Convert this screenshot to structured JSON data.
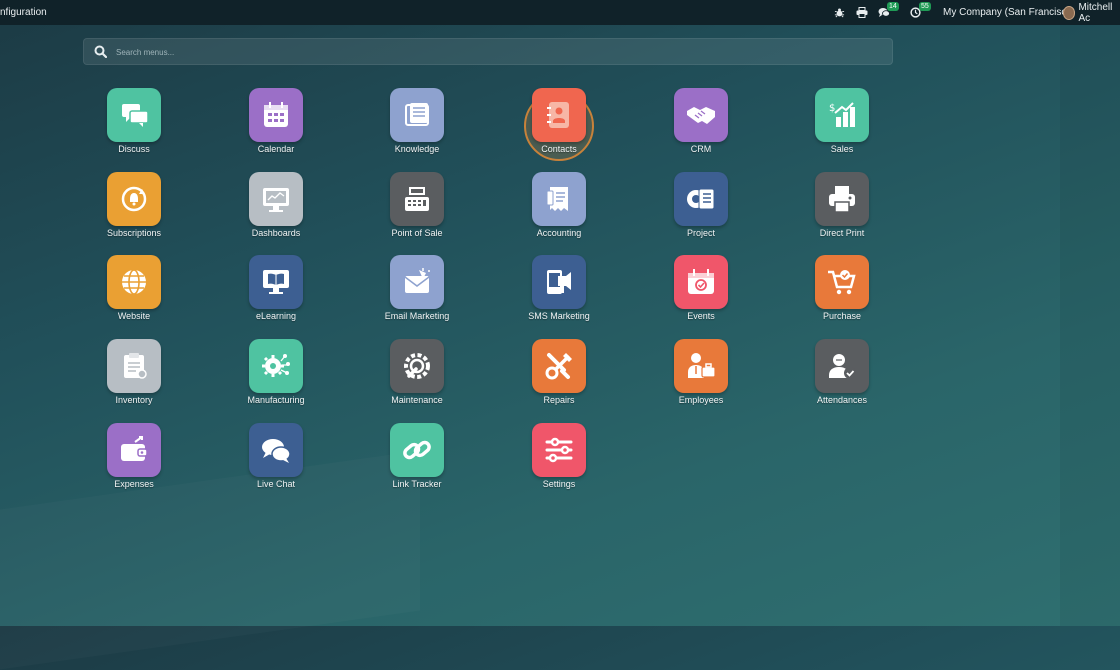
{
  "topbar": {
    "breadcrumb": "nfiguration",
    "messages_count": "14",
    "activities_count": "55",
    "company": "My Company (San Francisco)",
    "user": "Mitchell Ac"
  },
  "search": {
    "placeholder": "Search menus..."
  },
  "apps": [
    {
      "label": "Discuss",
      "icon": "discuss-icon",
      "color": "#4fc3a1"
    },
    {
      "label": "Calendar",
      "icon": "calendar-icon",
      "color": "#9b6fc7"
    },
    {
      "label": "Knowledge",
      "icon": "knowledge-icon",
      "color": "#8ea2cf"
    },
    {
      "label": "Contacts",
      "icon": "contacts-icon",
      "color": "#f0664f"
    },
    {
      "label": "CRM",
      "icon": "handshake-icon",
      "color": "#9b6fc7"
    },
    {
      "label": "Sales",
      "icon": "sales-chart-icon",
      "color": "#4fc3a1"
    },
    {
      "label": "Subscriptions",
      "icon": "subscriptions-icon",
      "color": "#eaa033"
    },
    {
      "label": "Dashboards",
      "icon": "dashboards-icon",
      "color": "#b7bec4"
    },
    {
      "label": "Point of Sale",
      "icon": "cash-register-icon",
      "color": "#5a5d60"
    },
    {
      "label": "Accounting",
      "icon": "accounting-icon",
      "color": "#8ea2cf"
    },
    {
      "label": "Project",
      "icon": "project-icon",
      "color": "#3d5f92"
    },
    {
      "label": "Direct Print",
      "icon": "printer-icon",
      "color": "#5a5d60"
    },
    {
      "label": "Website",
      "icon": "globe-icon",
      "color": "#eaa033"
    },
    {
      "label": "eLearning",
      "icon": "elearning-icon",
      "color": "#3d5f92"
    },
    {
      "label": "Email Marketing",
      "icon": "email-marketing-icon",
      "color": "#8ea2cf"
    },
    {
      "label": "SMS Marketing",
      "icon": "sms-marketing-icon",
      "color": "#3d5f92"
    },
    {
      "label": "Events",
      "icon": "events-icon",
      "color": "#f0566a"
    },
    {
      "label": "Purchase",
      "icon": "purchase-cart-icon",
      "color": "#e8793a"
    },
    {
      "label": "Inventory",
      "icon": "inventory-icon",
      "color": "#b7bec4"
    },
    {
      "label": "Manufacturing",
      "icon": "manufacturing-icon",
      "color": "#4fc3a1"
    },
    {
      "label": "Maintenance",
      "icon": "maintenance-icon",
      "color": "#5a5d60"
    },
    {
      "label": "Repairs",
      "icon": "repairs-icon",
      "color": "#e8793a"
    },
    {
      "label": "Employees",
      "icon": "employees-icon",
      "color": "#e8793a"
    },
    {
      "label": "Attendances",
      "icon": "attendances-icon",
      "color": "#5a5d60"
    },
    {
      "label": "Expenses",
      "icon": "expenses-icon",
      "color": "#9b6fc7"
    },
    {
      "label": "Live Chat",
      "icon": "live-chat-icon",
      "color": "#3d5f92"
    },
    {
      "label": "Link Tracker",
      "icon": "link-icon",
      "color": "#4fc3a1"
    },
    {
      "label": "Settings",
      "icon": "settings-sliders-icon",
      "color": "#f0566a"
    }
  ]
}
